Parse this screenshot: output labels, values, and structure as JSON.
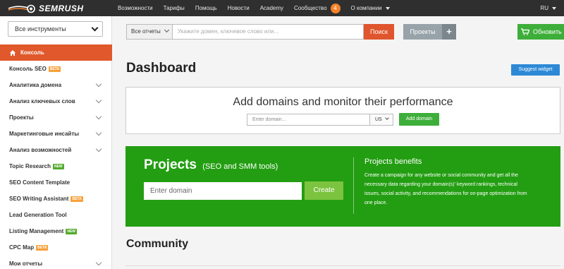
{
  "colors": {
    "topbar": "#2f2f2f",
    "accent_orange": "#e0582b",
    "green_primary": "#3eae3a",
    "projects_green": "#239e12",
    "create_green": "#7cc33f",
    "blue": "#2d89d6"
  },
  "brand": {
    "logo_text": "SEMRUSH",
    "logo_icon": "semrush-fire-icon"
  },
  "topnav": {
    "items": [
      "Возможности",
      "Тарифы",
      "Помощь",
      "Новости",
      "Academy"
    ],
    "community_label": "Сообщество",
    "community_count": "4",
    "company_label": "О компании",
    "language": "RU"
  },
  "sidebar": {
    "tools_select": "Все инструменты",
    "items": [
      {
        "label": "Консоль",
        "active": true,
        "icon": "home-icon"
      },
      {
        "label": "Консоль SEO",
        "tag": "BETA"
      },
      {
        "label": "Аналитика домена",
        "expandable": true
      },
      {
        "label": "Анализ ключевых слов",
        "expandable": true
      },
      {
        "label": "Проекты",
        "expandable": true
      },
      {
        "label": "Маркетинговые инсайты",
        "expandable": true
      },
      {
        "label": "Анализ возможностей",
        "expandable": true
      },
      {
        "label": "Topic Research",
        "tag": "NEW"
      },
      {
        "label": "SEO Content Template"
      },
      {
        "label": "SEO Writing Assistant",
        "tag": "BETA"
      },
      {
        "label": "Lead Generation Tool"
      },
      {
        "label": "Listing Management",
        "tag": "NEW"
      },
      {
        "label": "CPC Map",
        "tag": "BETA"
      },
      {
        "label": "Мои отчеты",
        "expandable": true
      }
    ]
  },
  "search": {
    "reports_select": "Все отчеты",
    "placeholder": "Укажите домен, ключевое слово или...",
    "button": "Поиск"
  },
  "projects_button": {
    "label": "Проекты",
    "plus": "+"
  },
  "upgrade_button": {
    "label": "Обновить",
    "icon": "cart-icon"
  },
  "main": {
    "title": "Dashboard",
    "suggest_widget": "Suggest widget",
    "add_domains": {
      "title": "Add domains and monitor their performance",
      "input_placeholder": "Enter domain...",
      "country": "US",
      "button": "Add domain"
    },
    "projects": {
      "heading": "Projects",
      "subheading": "(SEO and SMM tools)",
      "input_placeholder": "Enter domain",
      "create_button": "Create",
      "benefits_title": "Projects benefits",
      "benefits_text": "Create a campaign for any website or social community and get all the necessary data regarding your domain(s)' keyword rankings, technical issues, social activity, and recommendations for on-page optimization from one place."
    },
    "community_title": "Community"
  }
}
